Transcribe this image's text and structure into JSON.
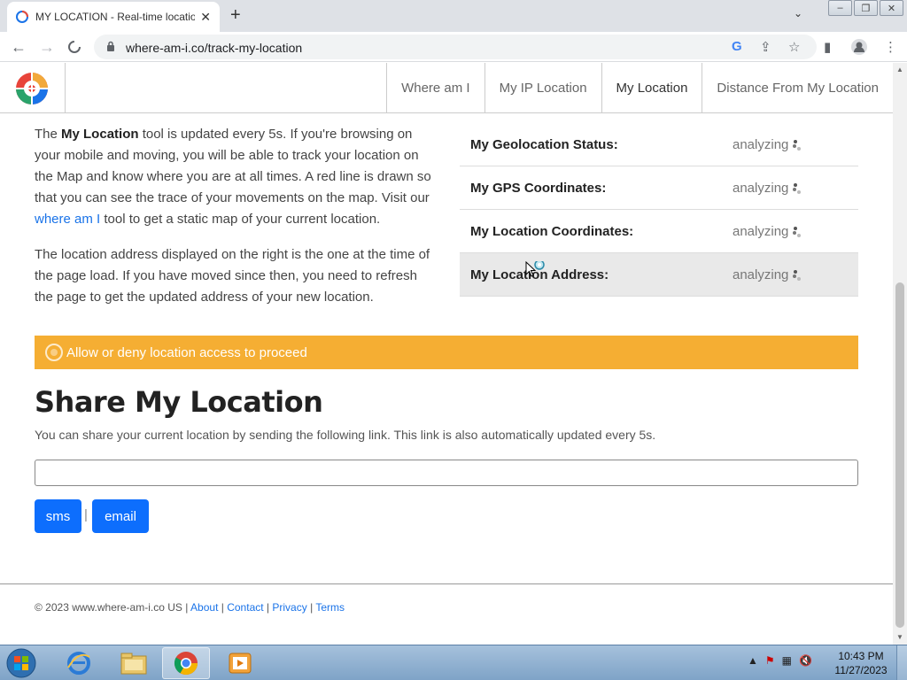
{
  "browser": {
    "tab_title": "MY LOCATION - Real-time locatio",
    "url": "where-am-i.co/track-my-location"
  },
  "site": {
    "nav": [
      "Where am I",
      "My IP Location",
      "My Location",
      "Distance From My Location"
    ],
    "active_nav": "My Location"
  },
  "intro": {
    "p1_a": "The ",
    "p1_bold": "My Location",
    "p1_b": " tool is updated every 5s. If you're browsing on your mobile and moving, you will be able to track your location on the Map and know where you are at all times. A red line is drawn so that you can see the trace of your movements on the map. Visit our ",
    "p1_link": "where am I",
    "p1_c": " tool to get a static map of your current location.",
    "p2": "The location address displayed on the right is the one at the time of the page load. If you have moved since then, you need to refresh the page to get the updated address of your new location."
  },
  "status": {
    "rows": [
      {
        "label": "My Geolocation Status:",
        "value": "analyzing"
      },
      {
        "label": "My GPS Coordinates:",
        "value": "analyzing"
      },
      {
        "label": "My Location Coordinates:",
        "value": "analyzing"
      },
      {
        "label": "My Location Address:",
        "value": "analyzing"
      }
    ]
  },
  "alert": {
    "text": "Allow or deny location access to proceed"
  },
  "share": {
    "title": "Share My Location",
    "text": "You can share your current location by sending the following link. This link is also automatically updated every 5s.",
    "input_value": "",
    "sms_label": "sms",
    "separator": "|",
    "email_label": "email"
  },
  "footer": {
    "copyright": "© 2023 www.where-am-i.co US",
    "links": [
      "About",
      "Contact",
      "Privacy",
      "Terms"
    ],
    "sep": "|"
  },
  "taskbar": {
    "time": "10:43 PM",
    "date": "11/27/2023"
  },
  "colors": {
    "alert": "#f5ae33",
    "button": "#0d6efd",
    "link": "#1a73e8"
  }
}
